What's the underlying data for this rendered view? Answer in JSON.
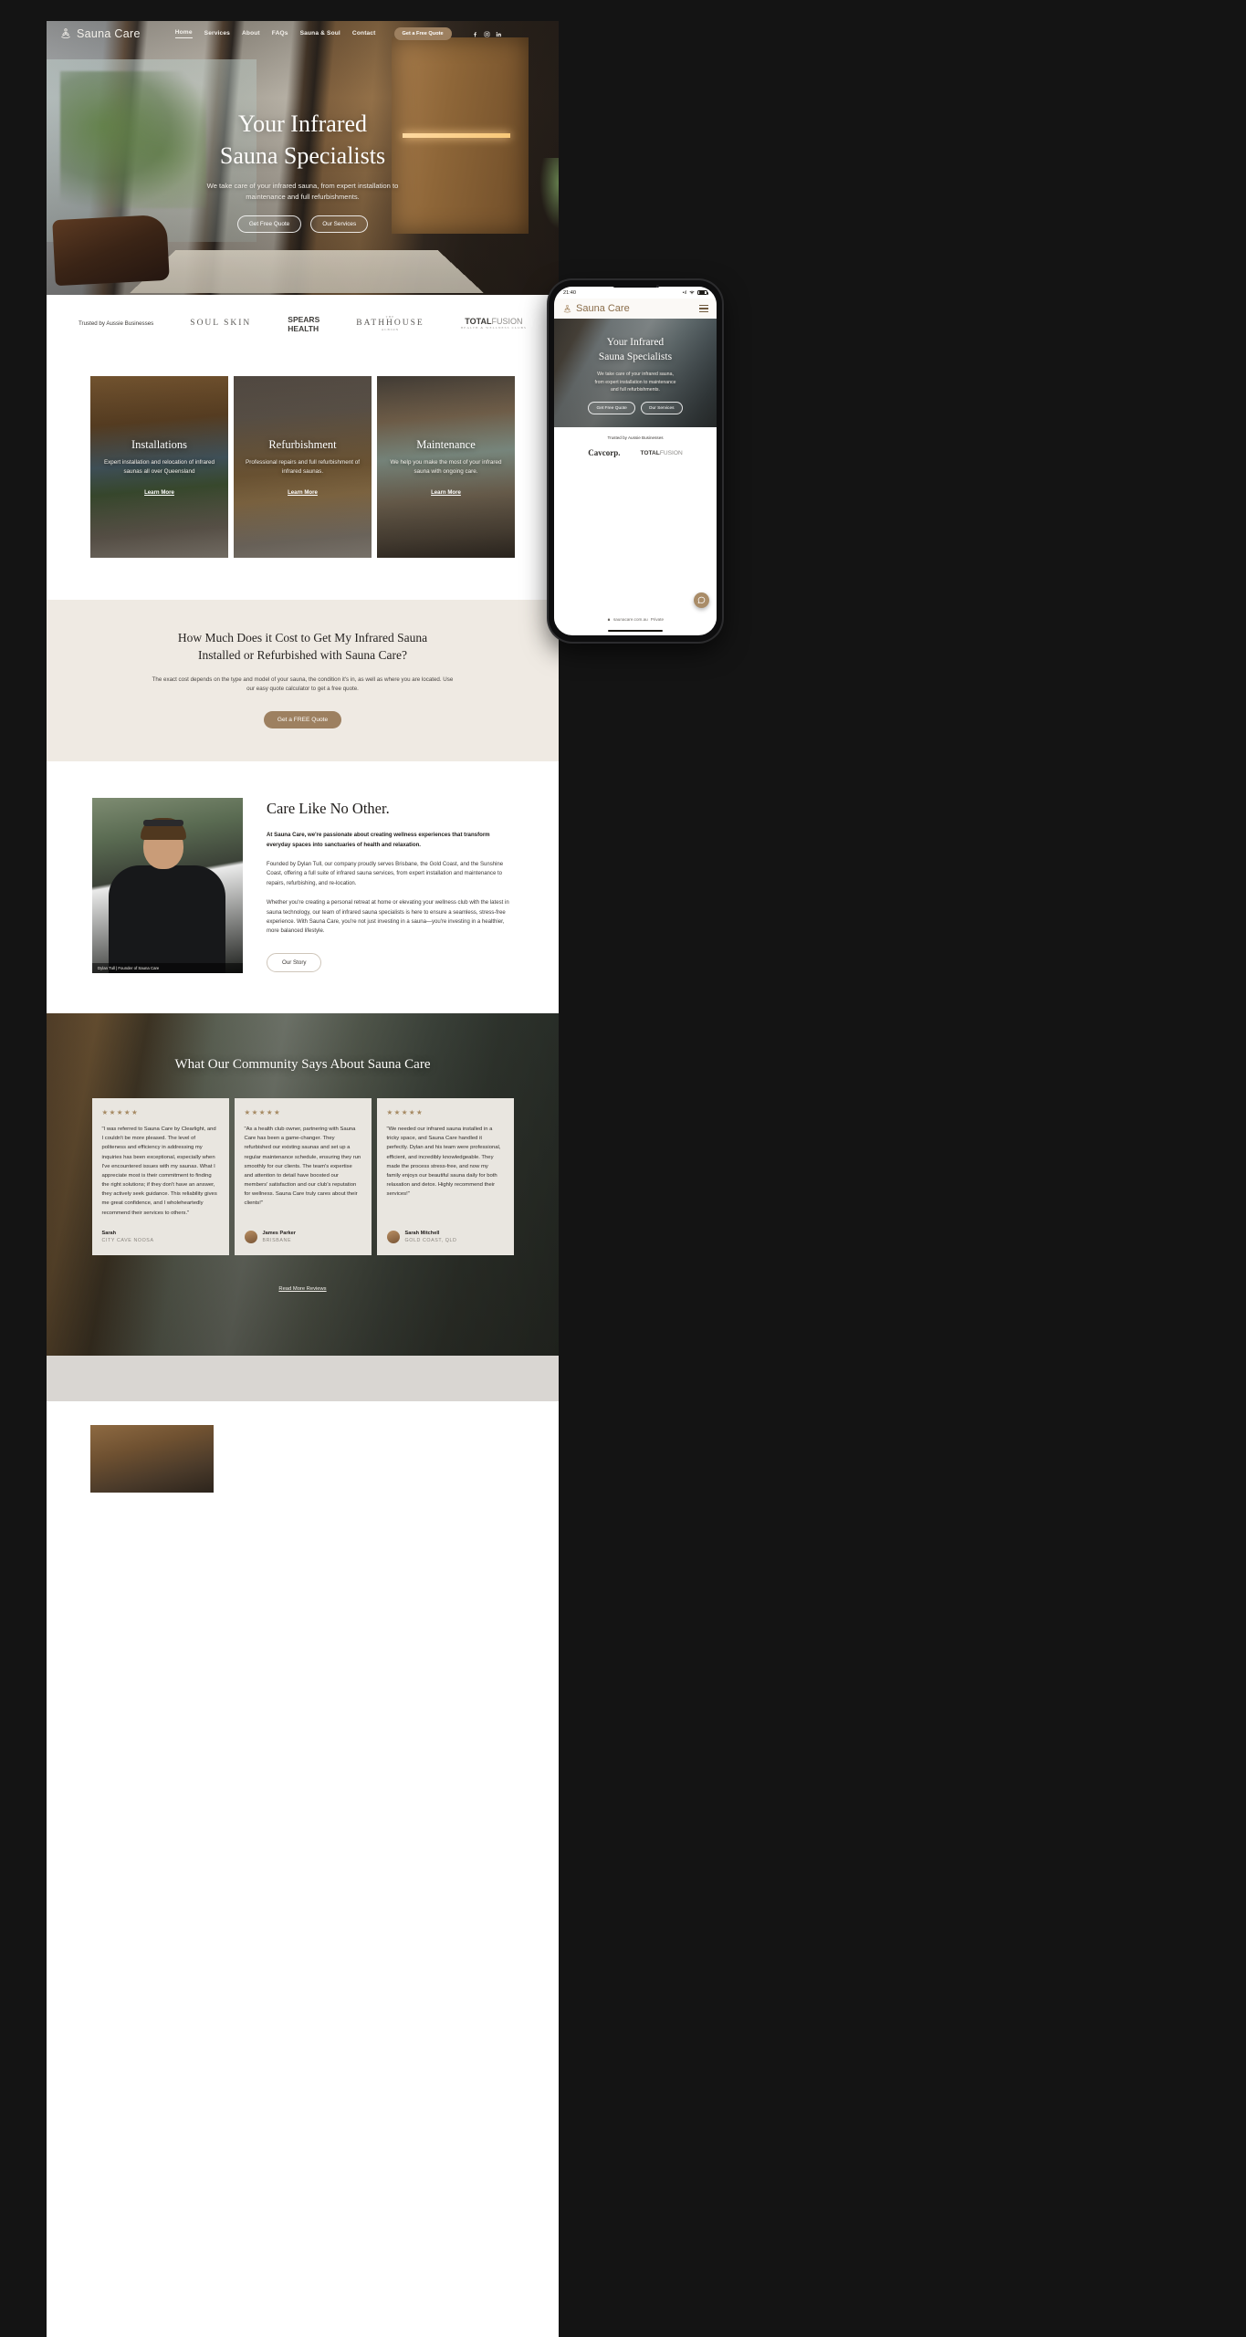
{
  "site": {
    "brand": "Sauna Care",
    "accent": "#9d8060",
    "band_bg": "#efeae3"
  },
  "nav": {
    "links": [
      {
        "label": "Home",
        "active": true
      },
      {
        "label": "Services",
        "active": false
      },
      {
        "label": "About",
        "active": false
      },
      {
        "label": "FAQs",
        "active": false
      },
      {
        "label": "Sauna & Soul",
        "active": false
      },
      {
        "label": "Contact",
        "active": false
      }
    ],
    "cta": "Get a Free Quote",
    "social": [
      "facebook-icon",
      "instagram-icon",
      "linkedin-icon"
    ]
  },
  "hero": {
    "title_line1": "Your Infrared",
    "title_line2": "Sauna Specialists",
    "subtitle_line1": "We take care of your infrared sauna, from expert installation to",
    "subtitle_line2": "maintenance and full refurbishments.",
    "btn_primary": "Get Free Quote",
    "btn_secondary": "Our Services"
  },
  "logos": {
    "label": "Trusted by Aussie Businesses",
    "items": [
      {
        "name": "SOUL SKIN",
        "kind": "soul-skin"
      },
      {
        "name": "SPEARS HEALTH",
        "kind": "spears-health"
      },
      {
        "name": "BATHHOUSE",
        "kind": "bathhouse",
        "top": "THE",
        "bottom": "ALBION"
      },
      {
        "name": "TOTALFUSION",
        "kind": "totalfusion",
        "bold": "TOTAL",
        "light": "FUSION",
        "sub": "HEALTH & WELLNESS CLUBS"
      }
    ]
  },
  "services": {
    "cards": [
      {
        "title": "Installations",
        "desc": "Expert installation and relocation of infrared saunas all over Queensland",
        "link": "Learn More"
      },
      {
        "title": "Refurbishment",
        "desc": "Professional repairs and full refurbishment of infrared saunas.",
        "link": "Learn More"
      },
      {
        "title": "Maintenance",
        "desc": "We help you make the most of your infrared sauna with ongoing care.",
        "link": "Learn More"
      }
    ]
  },
  "cost": {
    "heading_line1": "How Much Does it Cost to Get My Infrared Sauna",
    "heading_line2": "Installed or Refurbished with Sauna Care?",
    "paragraph": "The exact cost depends on the type and model of your sauna, the condition it's in, as well as where you are located. Use our easy quote calculator to get a free quote.",
    "cta": "Get a FREE Quote"
  },
  "about": {
    "photo_caption": "Dylan Tull | Founder of Sauna Care",
    "heading": "Care Like No Other.",
    "lead": "At Sauna Care, we're passionate about creating wellness experiences that transform everyday spaces into sanctuaries of health and relaxation.",
    "paragraph1": "Founded by Dylan Tull, our company proudly serves Brisbane, the Gold Coast, and the Sunshine Coast, offering a full suite of infrared sauna services, from expert installation and maintenance to repairs, refurbishing, and re-location.",
    "paragraph2": "Whether you're creating a personal retreat at home or elevating your wellness club with the latest in sauna technology, our team of infrared sauna specialists is here to ensure a seamless, stress-free experience. With Sauna Care, you're not just investing in a sauna—you're investing in a healthier, more balanced lifestyle.",
    "cta": "Our Story"
  },
  "testimonials": {
    "heading": "What Our Community Says About Sauna Care",
    "stars": "★★★★★",
    "items": [
      {
        "quote": "\"I was referred to Sauna Care by Clearlight, and I couldn't be more pleased. The level of politeness and efficiency in addressing my inquiries has been exceptional, especially when I've encountered issues with my saunas. What I appreciate most is their commitment to finding the right solutions; if they don't have an answer, they actively seek guidance. This reliability gives me great confidence, and I wholeheartedly recommend their services to others.\"",
        "name": "Sarah",
        "location": "CITY CAVE NOOSA",
        "has_avatar": false
      },
      {
        "quote": "\"As a health club owner, partnering with Sauna Care has been a game-changer. They refurbished our existing saunas and set up a regular maintenance schedule, ensuring they run smoothly for our clients. The team's expertise and attention to detail have boosted our members' satisfaction and our club's reputation for wellness. Sauna Care truly cares about their clients!\"",
        "name": "James Parker",
        "location": "BRISBANE",
        "has_avatar": true
      },
      {
        "quote": "\"We needed our infrared sauna installed in a tricky space, and Sauna Care handled it perfectly. Dylan and his team were professional, efficient, and incredibly knowledgeable. They made the process stress-free, and now my family enjoys our beautiful sauna daily for both relaxation and detox. Highly recommend their services!\"",
        "name": "Sarah Mitchell",
        "location": "GOLD COAST, QLD",
        "has_avatar": true
      }
    ],
    "read_more": "Read More Reviews"
  },
  "phone": {
    "status": {
      "time": "21:40",
      "signal": "•ıl",
      "wifi": "wifi-icon",
      "battery": "100"
    },
    "brand": "Sauna Care",
    "hero": {
      "title_line1": "Your Infrared",
      "title_line2": "Sauna Specialists",
      "subtitle_line1": "We take care of your infrared sauna,",
      "subtitle_line2": "from expert installation to maintenance",
      "subtitle_line3": "and full refurbishments.",
      "btn_primary": "Get Free Quote",
      "btn_secondary": "Our Services"
    },
    "logos_label": "Trusted by Aussie Businesses",
    "logo1": "Cavcorp.",
    "logo2_bold": "TOTAL",
    "logo2_light": "FUSION",
    "urlbar": {
      "lock": "lock-icon",
      "domain": "saunacare.com.au",
      "mode": "Private"
    },
    "chat": "chat-bubble-icon"
  }
}
